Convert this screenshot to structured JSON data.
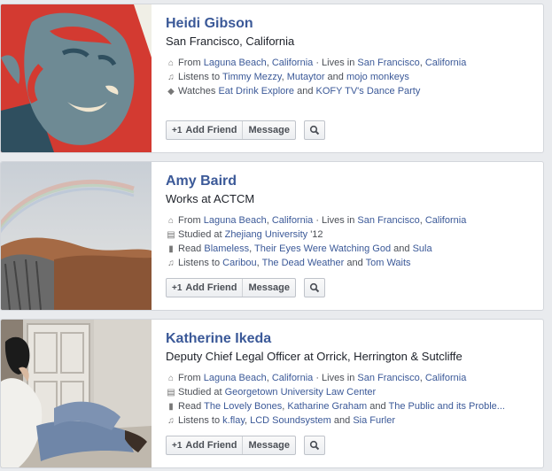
{
  "people": [
    {
      "name": "Heidi Gibson",
      "subtitle": "San Francisco, California",
      "details": [
        {
          "icon": "building-icon",
          "parts": [
            [
              "From ",
              0
            ],
            [
              "Laguna Beach",
              1
            ],
            [
              ", ",
              0
            ],
            [
              "California",
              1
            ],
            [
              " · Lives in ",
              0
            ],
            [
              "San Francisco",
              1
            ],
            [
              ", ",
              0
            ],
            [
              "California",
              1
            ]
          ]
        },
        {
          "icon": "music-note-icon",
          "parts": [
            [
              "Listens to ",
              0
            ],
            [
              "Timmy Mezzy",
              1
            ],
            [
              ", ",
              0
            ],
            [
              "Mutaytor",
              1
            ],
            [
              " and ",
              0
            ],
            [
              "mojo monkeys",
              1
            ]
          ]
        },
        {
          "icon": "tag-icon",
          "parts": [
            [
              "Watches ",
              0
            ],
            [
              "Eat Drink Explore",
              1
            ],
            [
              " and ",
              0
            ],
            [
              "KOFY TV's Dance Party",
              1
            ]
          ]
        }
      ]
    },
    {
      "name": "Amy Baird",
      "subtitle": "Works at ACTCM",
      "details": [
        {
          "icon": "building-icon",
          "parts": [
            [
              "From ",
              0
            ],
            [
              "Laguna Beach",
              1
            ],
            [
              ", ",
              0
            ],
            [
              "California",
              1
            ],
            [
              " · Lives in ",
              0
            ],
            [
              "San Francisco",
              1
            ],
            [
              ", ",
              0
            ],
            [
              "California",
              1
            ]
          ]
        },
        {
          "icon": "graduation-cap-icon",
          "parts": [
            [
              "Studied at ",
              0
            ],
            [
              "Zhejiang University",
              1
            ],
            [
              " '12",
              0
            ]
          ]
        },
        {
          "icon": "book-icon",
          "parts": [
            [
              "Read ",
              0
            ],
            [
              "Blameless",
              1
            ],
            [
              ", ",
              0
            ],
            [
              "Their Eyes Were Watching God",
              1
            ],
            [
              " and ",
              0
            ],
            [
              "Sula",
              1
            ]
          ]
        },
        {
          "icon": "music-note-icon",
          "parts": [
            [
              "Listens to ",
              0
            ],
            [
              "Caribou",
              1
            ],
            [
              ", ",
              0
            ],
            [
              "The Dead Weather",
              1
            ],
            [
              " and ",
              0
            ],
            [
              "Tom Waits",
              1
            ]
          ]
        }
      ]
    },
    {
      "name": "Katherine Ikeda",
      "subtitle": "Deputy Chief Legal Officer at Orrick, Herrington & Sutcliffe",
      "details": [
        {
          "icon": "building-icon",
          "parts": [
            [
              "From ",
              0
            ],
            [
              "Laguna Beach",
              1
            ],
            [
              ", ",
              0
            ],
            [
              "California",
              1
            ],
            [
              " · Lives in ",
              0
            ],
            [
              "San Francisco",
              1
            ],
            [
              ", ",
              0
            ],
            [
              "California",
              1
            ]
          ]
        },
        {
          "icon": "graduation-cap-icon",
          "parts": [
            [
              "Studied at ",
              0
            ],
            [
              "Georgetown University Law Center",
              1
            ]
          ]
        },
        {
          "icon": "book-icon",
          "parts": [
            [
              "Read ",
              0
            ],
            [
              "The Lovely Bones",
              1
            ],
            [
              ", ",
              0
            ],
            [
              "Katharine Graham",
              1
            ],
            [
              " and ",
              0
            ],
            [
              "The Public and its Proble...",
              1
            ]
          ]
        },
        {
          "icon": "music-note-icon",
          "parts": [
            [
              "Listens to ",
              0
            ],
            [
              "k.flay",
              1
            ],
            [
              ", ",
              0
            ],
            [
              "LCD Soundsystem",
              1
            ],
            [
              " and ",
              0
            ],
            [
              "Sia Furler",
              1
            ]
          ]
        }
      ]
    }
  ],
  "buttons": {
    "add_friend": "Add Friend",
    "message": "Message"
  },
  "colors": {
    "link": "#3b5998",
    "name": "#3b5998"
  }
}
